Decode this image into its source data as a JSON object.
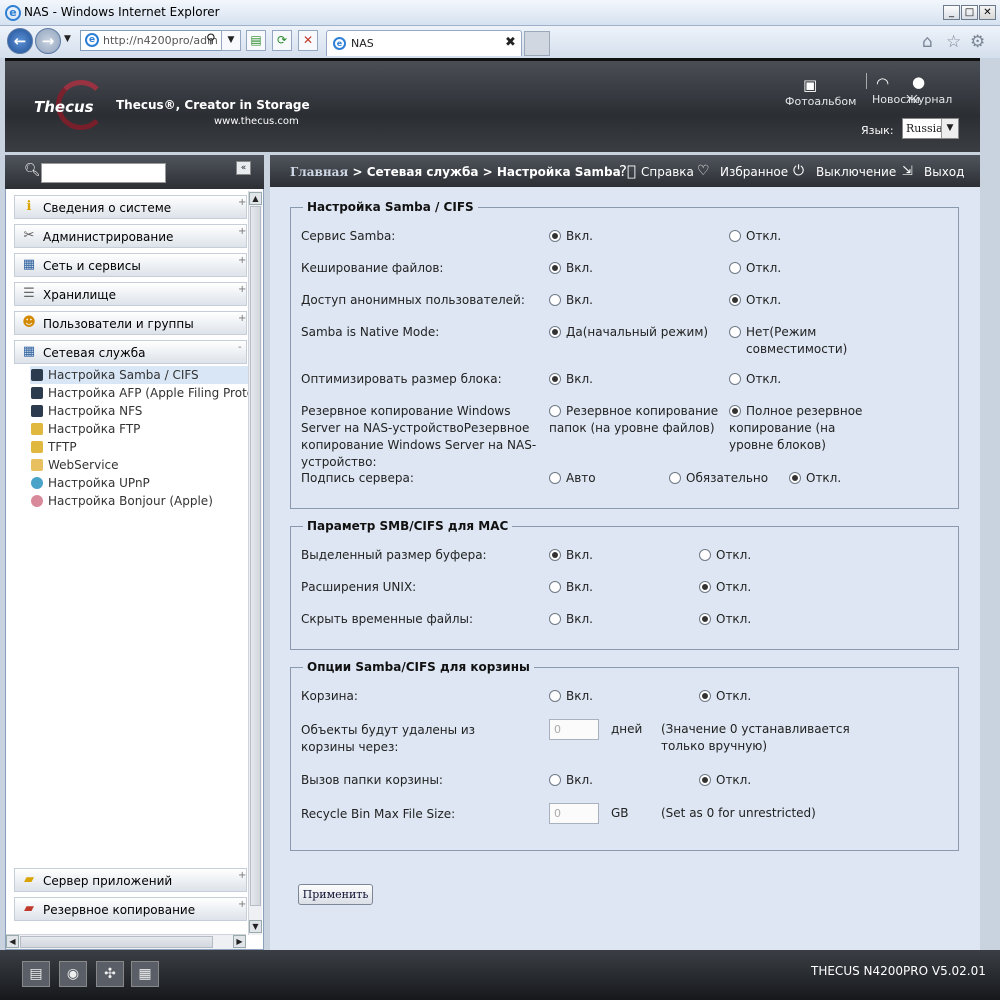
{
  "window": {
    "title": "NAS - Windows Internet Explorer"
  },
  "browser": {
    "address": "http://n4200pro/adm",
    "tab_label": "NAS",
    "tab_close": "✖"
  },
  "brand": {
    "logo": "Thecus",
    "slogan": "Thecus®, Creator in Storage",
    "site": "www.thecus.com"
  },
  "header": {
    "photo_album": "Фотоальбом",
    "news": "Новости",
    "log": "Журнал",
    "language_label": "Язык:",
    "language_value": "Russia"
  },
  "sidebar": {
    "categories_top": [
      {
        "label": "Сведения о системе",
        "icon": "info-icon"
      },
      {
        "label": "Администрирование",
        "icon": "tools-icon"
      },
      {
        "label": "Сеть и сервисы",
        "icon": "network-icon"
      },
      {
        "label": "Хранилище",
        "icon": "storage-icon"
      },
      {
        "label": "Пользователи и группы",
        "icon": "users-icon"
      },
      {
        "label": "Сетевая служба",
        "icon": "network-service-icon"
      }
    ],
    "subitems": [
      {
        "label": "Настройка Samba / CIFS",
        "selected": true
      },
      {
        "label": "Настройка AFP (Apple Filing Protocol)"
      },
      {
        "label": "Настройка NFS"
      },
      {
        "label": "Настройка FTP"
      },
      {
        "label": "TFTP"
      },
      {
        "label": "WebService"
      },
      {
        "label": "Настройка UPnP"
      },
      {
        "label": "Настройка Bonjour (Apple)"
      }
    ],
    "categories_bottom": [
      {
        "label": "Сервер приложений",
        "icon": "app-server-icon"
      },
      {
        "label": "Резервное копирование",
        "icon": "backup-icon"
      }
    ]
  },
  "breadcrumb": {
    "home": "Главная",
    "path": " > Сетевая служба > Настройка Samba / CIFS"
  },
  "header_links": {
    "help": "Справка",
    "favorites": "Избранное",
    "shutdown": "Выключение",
    "logout": "Выход"
  },
  "samba": {
    "legend": "Настройка Samba / CIFS",
    "rows": [
      {
        "label": "Сервис Samba:",
        "opt1": "Вкл.",
        "opt2": "Откл.",
        "selected": 1
      },
      {
        "label": "Кеширование файлов:",
        "opt1": "Вкл.",
        "opt2": "Откл.",
        "selected": 1
      },
      {
        "label": "Доступ анонимных пользователей:",
        "opt1": "Вкл.",
        "opt2": "Откл.",
        "selected": 2
      },
      {
        "label": "Samba is Native Mode:",
        "opt1": "Да(начальный режим)",
        "opt2": "Нет(Режим совместимости)",
        "selected": 1
      },
      {
        "label": "Оптимизировать размер блока:",
        "opt1": "Вкл.",
        "opt2": "Откл.",
        "selected": 1
      },
      {
        "label": "Резервное копирование Windows Server на NAS-устройствоРезервное копирование Windows Server на NAS-устройство:",
        "opt1": "Резервное копирование папок (на уровне файлов)",
        "opt2": "Полное резервное копирование (на уровне блоков)",
        "selected": 2
      }
    ],
    "signing": {
      "label": "Подпись сервера:",
      "opt1": "Авто",
      "opt2": "Обязательно",
      "opt3": "Откл.",
      "selected": 3
    }
  },
  "mac": {
    "legend": "Параметр SMB/CIFS для MAC",
    "rows": [
      {
        "label": "Выделенный размер буфера:",
        "opt1": "Вкл.",
        "opt2": "Откл.",
        "selected": 1
      },
      {
        "label": "Расширения UNIX:",
        "opt1": "Вкл.",
        "opt2": "Откл.",
        "selected": 2
      },
      {
        "label": "Скрыть временные файлы:",
        "opt1": "Вкл.",
        "opt2": "Откл.",
        "selected": 2
      }
    ]
  },
  "recycle": {
    "legend": "Опции Samba/CIFS для корзины",
    "bin": {
      "label": "Корзина:",
      "opt1": "Вкл.",
      "opt2": "Откл.",
      "selected": 2
    },
    "delete_after": {
      "label": "Объекты будут удалены из корзины через:",
      "placeholder": "0",
      "unit": "дней",
      "note": "(Значение 0 устанавливается только вручную)"
    },
    "call": {
      "label": "Вызов папки корзины:",
      "opt1": "Вкл.",
      "opt2": "Откл.",
      "selected": 2
    },
    "max_size": {
      "label": "Recycle Bin Max File Size:",
      "placeholder": "0",
      "unit": "GB",
      "note": "(Set as 0 for unrestricted)"
    }
  },
  "apply_label": "Применить",
  "footer": {
    "version": "THECUS N4200PRO V5.02.01"
  }
}
